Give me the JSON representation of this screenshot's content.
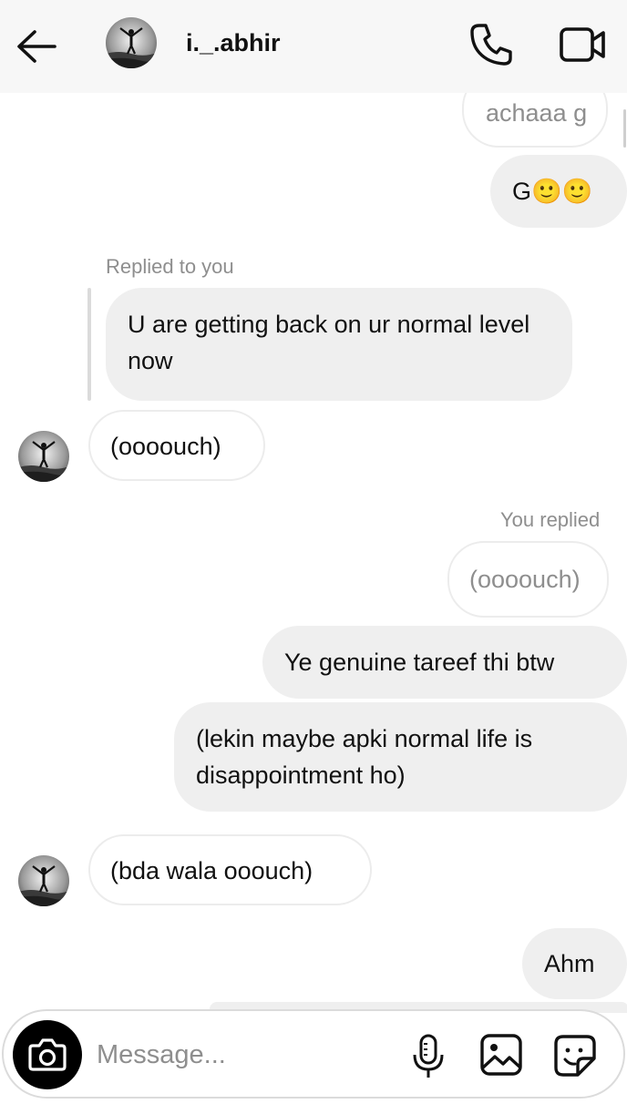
{
  "header": {
    "username": "i._.abhir",
    "back_icon": "arrow-left-icon",
    "call_icon": "phone-icon",
    "video_icon": "video-camera-icon"
  },
  "thread": {
    "msg_prev_sent_quote": "achaaa g",
    "msg_sent_g_emoji": "G🙂🙂",
    "reply_label_received": "Replied to you",
    "quoted_received": "U are getting back on ur normal level now",
    "msg_received_1": "(oooouch)",
    "reply_label_sent": "You replied",
    "quoted_sent": "(oooouch)",
    "msg_sent_1": "Ye genuine tareef thi btw",
    "msg_sent_2": "(lekin maybe apki normal life is disappointment ho)",
    "msg_received_2": "(bda wala ooouch)",
    "msg_sent_3": "Ahm"
  },
  "composer": {
    "placeholder": "Message...",
    "camera_icon": "camera-icon",
    "mic_icon": "microphone-icon",
    "gallery_icon": "image-icon",
    "sticker_icon": "sticker-icon"
  },
  "colors": {
    "bubble_grey": "#efefef",
    "bubble_outline": "#ececec",
    "meta_text": "#8e8e8e",
    "header_bg": "#f7f7f7"
  }
}
